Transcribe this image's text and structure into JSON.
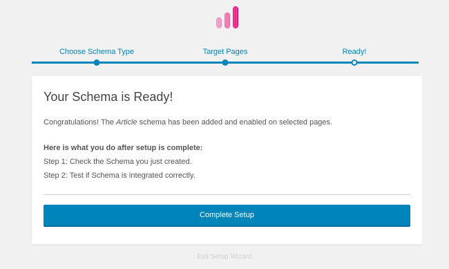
{
  "steps": [
    {
      "label": "Choose Schema Type"
    },
    {
      "label": "Target Pages"
    },
    {
      "label": "Ready!"
    }
  ],
  "card": {
    "title": "Your Schema is Ready!",
    "congrats_prefix": "Congratulations! The ",
    "schema_name": "Article",
    "congrats_suffix": " schema has been added and enabled on selected pages.",
    "after_title": "Here is what you do after setup is complete:",
    "step1": "Step 1: Check the Schema you just created.",
    "step2": "Step 2: Test if Schema is integrated correctly.",
    "button_label": "Complete Setup"
  },
  "exit_link": "Exit Setup Wizard",
  "colors": {
    "accent": "#0085ba",
    "logo_dark": "#e6007e",
    "logo_light": "#f080b8"
  }
}
